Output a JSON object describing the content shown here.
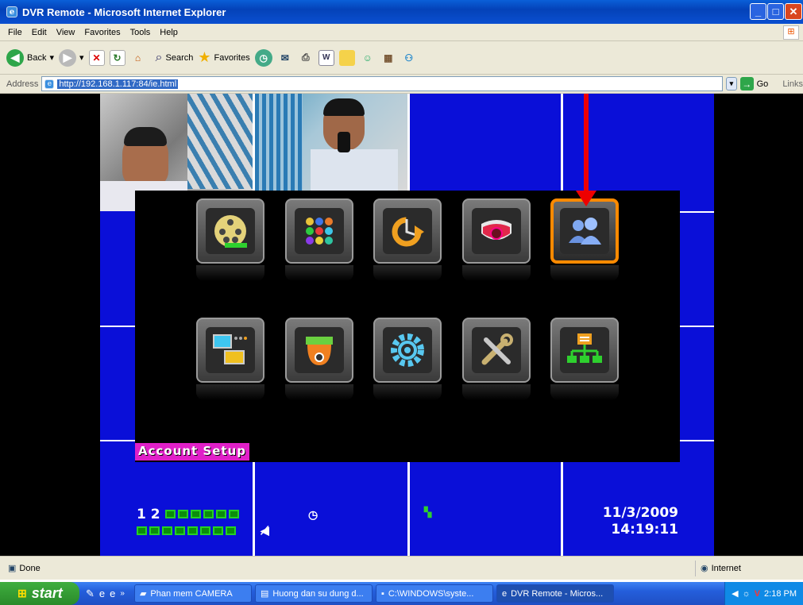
{
  "window": {
    "title": "DVR Remote - Microsoft Internet Explorer"
  },
  "menubar": {
    "items": [
      "File",
      "Edit",
      "View",
      "Favorites",
      "Tools",
      "Help"
    ]
  },
  "toolbar": {
    "back_label": "Back",
    "search_label": "Search",
    "favorites_label": "Favorites"
  },
  "address": {
    "label": "Address",
    "url": "http://192.168.1.117:84/ie.html",
    "go_label": "Go",
    "links_label": "Links"
  },
  "dvr": {
    "selected_item_label": "Account Setup",
    "channel_prefix": "1 2",
    "date": "11/3/2009",
    "time": "14:19:11",
    "menu_icons_row1": [
      "playback-icon",
      "display-grid-icon",
      "backup-icon",
      "motion-camera-icon",
      "account-users-icon"
    ],
    "menu_icons_row2": [
      "network-monitor-icon",
      "ptz-camera-icon",
      "settings-gear-icon",
      "tools-icon",
      "system-tree-icon"
    ]
  },
  "statusbar": {
    "left": "Done",
    "zone": "Internet"
  },
  "taskbar": {
    "start_label": "start",
    "tasks": [
      "Phan mem CAMERA",
      "Huong dan su dung d...",
      "C:\\WINDOWS\\syste...",
      "DVR Remote - Micros..."
    ],
    "clock": "2:18 PM"
  },
  "colors": {
    "accent": "#ff8a00",
    "dvr_bg": "#0a0fd8",
    "label_bg": "#e020c8",
    "arrow": "#ee0000"
  }
}
